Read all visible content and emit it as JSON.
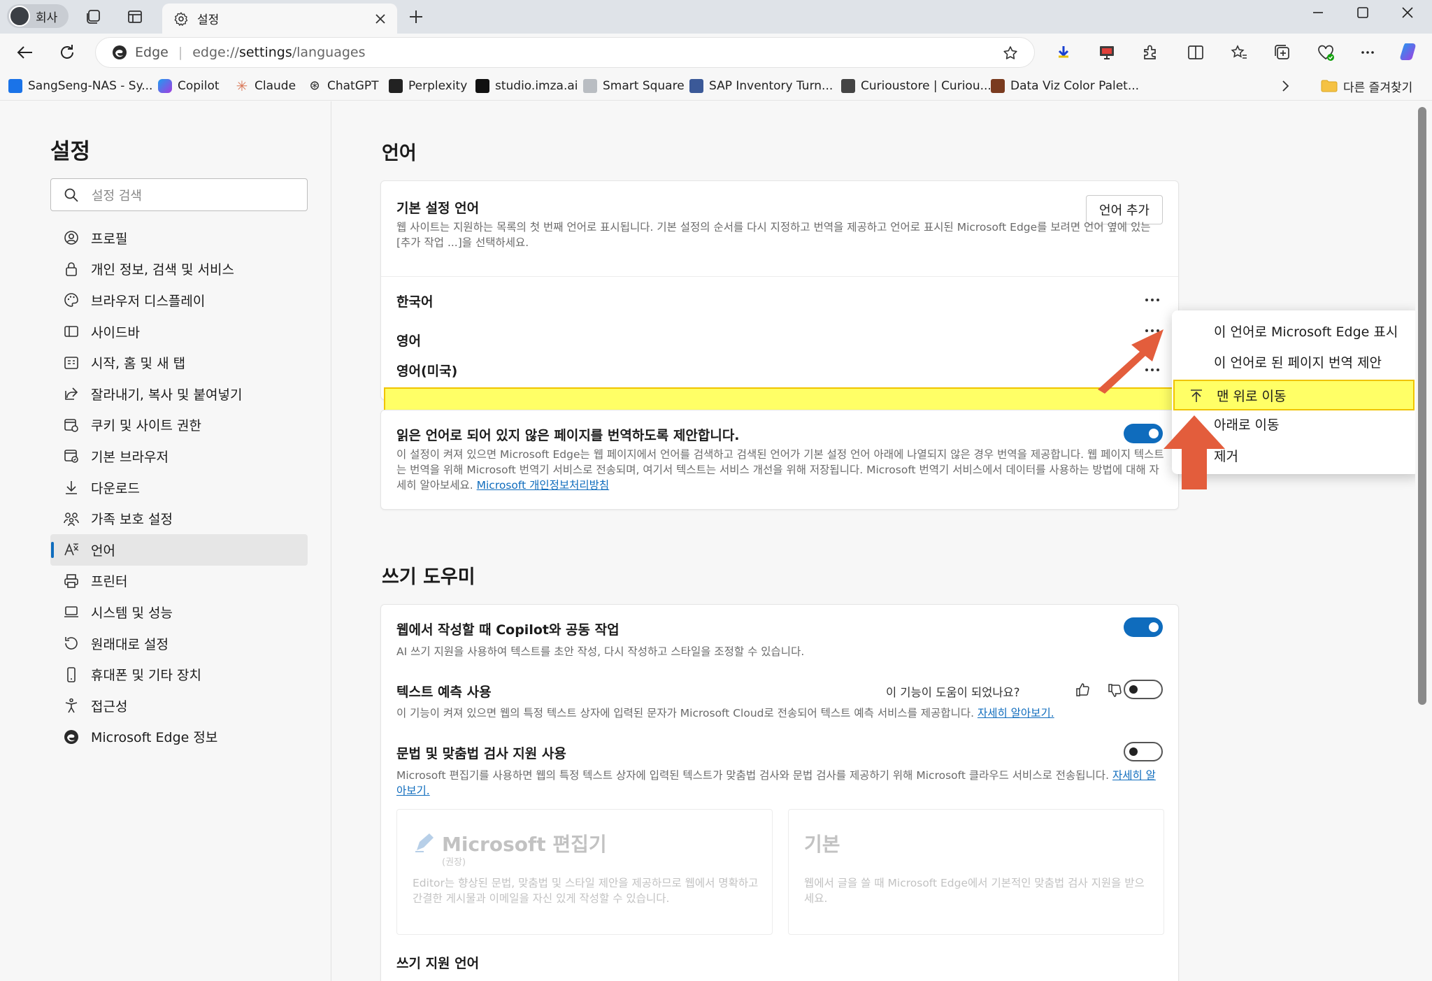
{
  "browser": {
    "profile_label": "회사",
    "tab_title": "설정",
    "address": {
      "edge_name": "Edge",
      "url_prefix": "edge://",
      "url_bold": "settings",
      "url_suffix": "/languages"
    },
    "favorites": [
      {
        "label": "SangSeng-NAS - Sy...",
        "icon": "dsm-icon",
        "color": "#1a73e8"
      },
      {
        "label": "Copilot",
        "icon": "copilot-icon",
        "color": "#8e44ec"
      },
      {
        "label": "Claude",
        "icon": "claude-icon",
        "color": "#d97757"
      },
      {
        "label": "ChatGPT",
        "icon": "chatgpt-icon",
        "color": "#222222"
      },
      {
        "label": "Perplexity",
        "icon": "perplexity-icon",
        "color": "#222222"
      },
      {
        "label": "studio.imza.ai",
        "icon": "imza-icon",
        "color": "#111111"
      },
      {
        "label": "Smart Square",
        "icon": "smartsquare-icon",
        "color": "#9aa0a6"
      },
      {
        "label": "SAP Inventory Turn...",
        "icon": "sap-icon",
        "color": "#3b5998"
      },
      {
        "label": "Curioustore | Curiou...",
        "icon": "curioustore-icon",
        "color": "#444444"
      },
      {
        "label": "Data Viz Color Palet...",
        "icon": "dataviz-icon",
        "color": "#7a3b1f"
      }
    ],
    "other_favorites": "다른 즐겨찾기"
  },
  "sidebar": {
    "title": "설정",
    "search_placeholder": "설정 검색",
    "items": [
      {
        "label": "프로필",
        "icon": "profile-icon"
      },
      {
        "label": "개인 정보, 검색 및 서비스",
        "icon": "lock-icon"
      },
      {
        "label": "브라우저 디스플레이",
        "icon": "palette-icon"
      },
      {
        "label": "사이드바",
        "icon": "sidebar-icon"
      },
      {
        "label": "시작, 홈 및 새 탭",
        "icon": "home-tabs-icon"
      },
      {
        "label": "잘라내기, 복사 및 붙여넣기",
        "icon": "share-icon"
      },
      {
        "label": "쿠키 및 사이트 권한",
        "icon": "cookie-permissions-icon"
      },
      {
        "label": "기본 브라우저",
        "icon": "default-browser-icon"
      },
      {
        "label": "다운로드",
        "icon": "download-icon"
      },
      {
        "label": "가족 보호 설정",
        "icon": "family-icon"
      },
      {
        "label": "언어",
        "icon": "language-icon",
        "active": true
      },
      {
        "label": "프린터",
        "icon": "printer-icon"
      },
      {
        "label": "시스템 및 성능",
        "icon": "laptop-icon"
      },
      {
        "label": "원래대로 설정",
        "icon": "reset-icon"
      },
      {
        "label": "휴대폰 및 기타 장치",
        "icon": "phone-icon"
      },
      {
        "label": "접근성",
        "icon": "accessibility-icon"
      },
      {
        "label": "Microsoft Edge 정보",
        "icon": "edge-logo-icon"
      }
    ]
  },
  "languages": {
    "section_title": "언어",
    "preferred_title": "기본 설정 언어",
    "preferred_desc": "웹 사이트는 지원하는 목록의 첫 번째 언어로 표시됩니다. 기본 설정의 순서를 다시 지정하고 번역을 제공하고 언어로 표시된 Microsoft Edge를 보려면 언어 옆에 있는 [추가 작업 ...]을 선택하세요.",
    "add_button": "언어 추가",
    "list": [
      "한국어",
      "영어",
      "영어(미국)"
    ],
    "translate_title": "읽은 언어로 되어 있지 않은 페이지를 번역하도록 제안합니다.",
    "translate_desc": "이 설정이 켜져 있으면 Microsoft Edge는 웹 페이지에서 언어를 검색하고 검색된 언어가 기본 설정 언어 아래에 나열되지 않은 경우 번역을 제공합니다. 웹 페이지 텍스트는 번역을 위해 Microsoft 번역기 서비스로 전송되며, 여기서 텍스트는 서비스 개선을 위해 저장됩니다. Microsoft 번역기 서비스에서 데이터를 사용하는 방법에 대해 자세히 알아보세요.",
    "translate_link": "Microsoft 개인정보처리방침",
    "translate_on": true
  },
  "writing": {
    "section_title": "쓰기 도우미",
    "copilot_title": "웹에서 작성할 때 Copilot와 공동 작업",
    "copilot_desc": "AI 쓰기 지원을 사용하여 텍스트를 초안 작성, 다시 작성하고 스타일을 조정할 수 있습니다.",
    "copilot_on": true,
    "prediction_title": "텍스트 예측 사용",
    "prediction_help": "이 기능이 도움이 되었나요?",
    "prediction_desc": "이 기능이 켜져 있으면 웹의 특정 텍스트 상자에 입력된 문자가 Microsoft Cloud로 전송되어 텍스트 예측 서비스를 제공합니다.",
    "prediction_link": "자세히 알아보기.",
    "prediction_on": false,
    "grammar_title": "문법 및 맞춤법 검사 지원 사용",
    "grammar_desc": "Microsoft 편집기를 사용하면 웹의 특정 텍스트 상자에 입력된 텍스트가 맞춤법 검사와 문법 검사를 제공하기 위해 Microsoft 클라우드 서비스로 전송됩니다.",
    "grammar_link": "자세히 알아보기.",
    "grammar_on": false,
    "editor_card": {
      "title": "Microsoft 편집기",
      "sub": "(권장)",
      "desc": "Editor는 향상된 문법, 맞춤법 및 스타일 제안을 제공하므로 웹에서 명확하고 간결한 게시물과 이메일을 자신 있게 작성할 수 있습니다."
    },
    "basic_card": {
      "title": "기본",
      "desc": "웹에서 글을 쓸 때 Microsoft Edge에서 기본적인 맞춤법 검사 지원을 받으세요."
    },
    "writing_langs_title": "쓰기 지원 언어"
  },
  "context_menu": {
    "items": [
      {
        "label": "이 언어로 Microsoft Edge 표시"
      },
      {
        "label": "이 언어로 된 페이지 번역 제안"
      },
      {
        "label": "맨 위로 이동",
        "icon": "move-to-top-icon",
        "highlighted": true
      },
      {
        "label": "아래로 이동"
      },
      {
        "label": "제거"
      }
    ]
  },
  "colors": {
    "accent": "#0f6cbd",
    "highlight": "#ffff66",
    "annotation_arrow": "#e35d3c"
  }
}
